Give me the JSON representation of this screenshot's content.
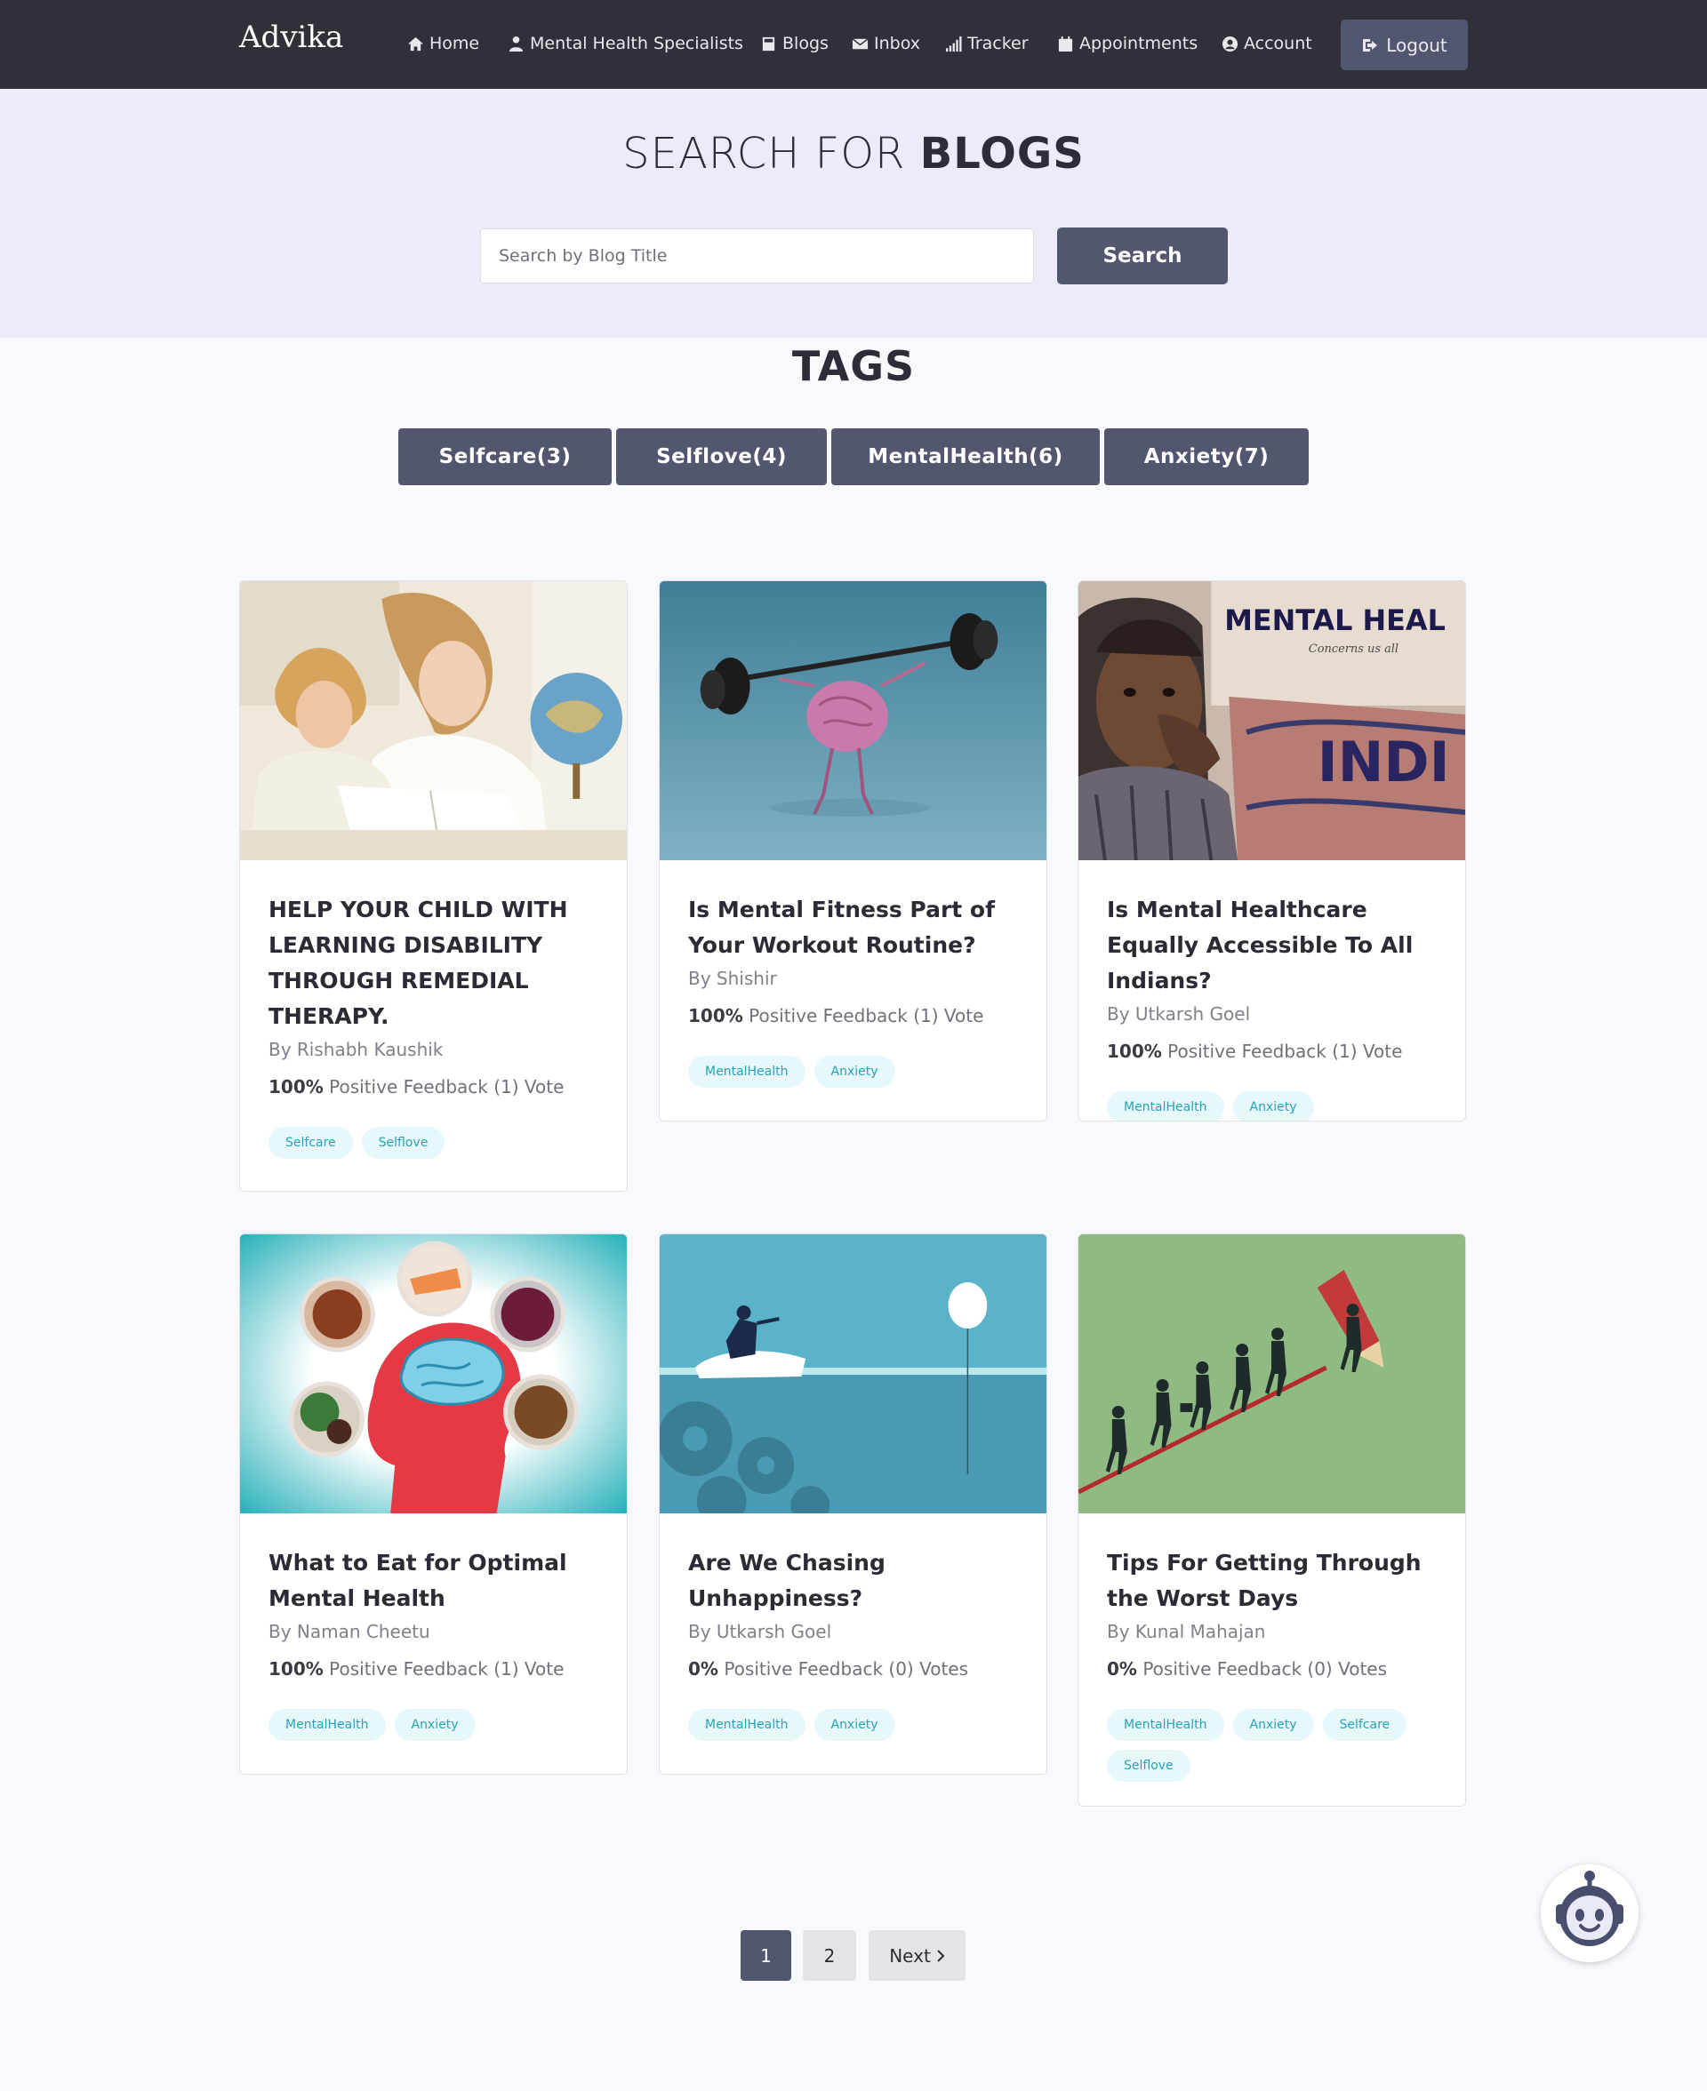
{
  "nav": {
    "brand": "Advika",
    "links": [
      {
        "label": "Home",
        "icon": "home-icon"
      },
      {
        "label": "Mental Health Specialists",
        "icon": "user-md-icon"
      },
      {
        "label": "Blogs",
        "icon": "book-icon"
      },
      {
        "label": "Inbox",
        "icon": "envelope-icon"
      },
      {
        "label": "Tracker",
        "icon": "signal-icon"
      },
      {
        "label": "Appointments",
        "icon": "calendar-icon"
      },
      {
        "label": "Account",
        "icon": "user-circle-icon"
      }
    ],
    "logout": "Logout"
  },
  "hero": {
    "title_thin": "SEARCH FOR ",
    "title_bold": "BLOGS",
    "search_placeholder": "Search by Blog Title",
    "search_button": "Search"
  },
  "tags": {
    "title": "TAGS",
    "items": [
      "Selfcare(3)",
      "Selflove(4)",
      "MentalHealth(6)",
      "Anxiety(7)"
    ]
  },
  "blogs": [
    {
      "title": "HELP YOUR CHILD WITH LEARNING DISABILITY THROUGH REMEDIAL THERAPY.",
      "author": "By Rishabh Kaushik",
      "percent": "100%",
      "feedback": "Positive Feedback (1) Vote",
      "tags": [
        "Selfcare",
        "Selflove"
      ],
      "image": "woman-reading-with-child-image"
    },
    {
      "title": "Is Mental Fitness Part of Your Workout Routine?",
      "author": "By Shishir",
      "percent": "100%",
      "feedback": "Positive Feedback (1) Vote",
      "tags": [
        "MentalHealth",
        "Anxiety"
      ],
      "image": "brain-lifting-barbell-image"
    },
    {
      "title": "Is Mental Healthcare Equally Accessible To All Indians?",
      "author": "By Utkarsh Goel",
      "percent": "100%",
      "feedback": "Positive Feedback (1) Vote",
      "tags": [
        "MentalHealth",
        "Anxiety"
      ],
      "image": "boy-mental-health-india-image",
      "image_text": [
        "MENTAL HEAL",
        "Concerns us all",
        "INDI"
      ]
    },
    {
      "title": "What to Eat for Optimal Mental Health",
      "author": "By Naman Cheetu",
      "percent": "100%",
      "feedback": "Positive Feedback (1) Vote",
      "tags": [
        "MentalHealth",
        "Anxiety"
      ],
      "image": "brain-food-image"
    },
    {
      "title": "Are We Chasing Unhappiness?",
      "author": "By Utkarsh Goel",
      "percent": "0%",
      "feedback": "Positive Feedback (0) Votes",
      "tags": [
        "MentalHealth",
        "Anxiety"
      ],
      "image": "jetski-balloon-gears-image"
    },
    {
      "title": "Tips For Getting Through the Worst Days",
      "author": "By Kunal Mahajan",
      "percent": "0%",
      "feedback": "Positive Feedback (0) Votes",
      "tags": [
        "MentalHealth",
        "Anxiety",
        "Selfcare",
        "Selflove"
      ],
      "image": "people-climbing-pencil-image"
    }
  ],
  "pagination": {
    "pages": [
      "1",
      "2"
    ],
    "active": "1",
    "next": "Next"
  },
  "colors": {
    "navbar": "#303038",
    "button": "#53566f",
    "hero_bg": "#ececf9",
    "page_bg": "#f8f9fd",
    "pill_bg": "#e7f8fa",
    "pill_text": "#27a2b8"
  }
}
